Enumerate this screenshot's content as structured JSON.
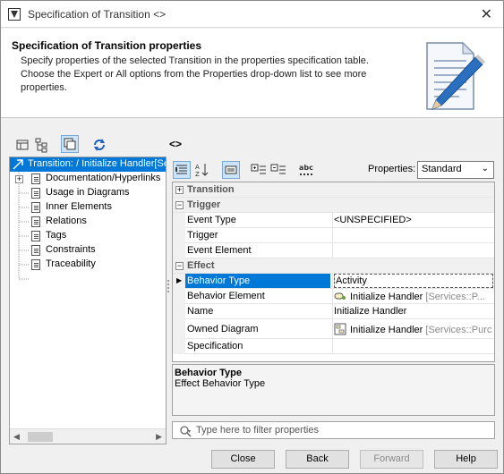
{
  "window": {
    "title": "Specification of Transition <>"
  },
  "header": {
    "title": "Specification of Transition properties",
    "description": "Specify properties of the selected Transition in the properties specification table. Choose the Expert or All options from the Properties drop-down list to see more properties."
  },
  "element_name": "<>",
  "tree": {
    "items": [
      {
        "label": "Transition: / Initialize Handler[Se",
        "selected": true
      },
      {
        "label": "Documentation/Hyperlinks"
      },
      {
        "label": "Usage in Diagrams"
      },
      {
        "label": "Inner Elements"
      },
      {
        "label": "Relations"
      },
      {
        "label": "Tags"
      },
      {
        "label": "Constraints"
      },
      {
        "label": "Traceability"
      }
    ]
  },
  "properties": {
    "label": "Properties:",
    "selected": "Standard"
  },
  "grid": {
    "categories": {
      "transition": "Transition",
      "trigger": "Trigger",
      "effect": "Effect"
    },
    "trigger_rows": [
      {
        "name": "Event Type",
        "value": "<UNSPECIFIED>"
      },
      {
        "name": "Trigger",
        "value": ""
      },
      {
        "name": "Event Element",
        "value": ""
      }
    ],
    "effect_rows": [
      {
        "name": "Behavior Type",
        "value": "Activity",
        "selected": true
      },
      {
        "name": "Behavior Element",
        "value": "Initialize Handler",
        "value_extra": "[Services::P..."
      },
      {
        "name": "Name",
        "value": "Initialize Handler"
      },
      {
        "name": "Owned Diagram",
        "value": "Initialize Handler",
        "value_extra": "[Services::Purc"
      },
      {
        "name": "Specification",
        "value": ""
      }
    ]
  },
  "description_panel": {
    "title": "Behavior Type",
    "text": "Effect Behavior Type"
  },
  "filter": {
    "placeholder": "Type here to filter properties"
  },
  "buttons": {
    "close": "Close",
    "back": "Back",
    "forward": "Forward",
    "help": "Help"
  }
}
